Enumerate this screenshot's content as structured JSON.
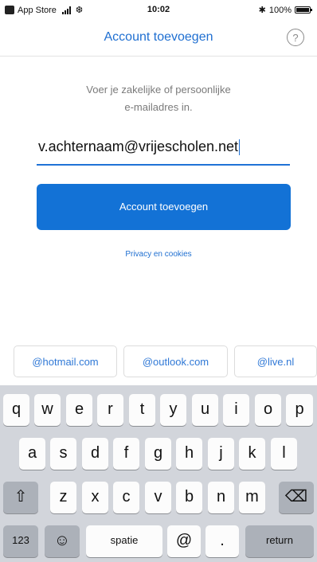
{
  "status_bar": {
    "carrier": "App Store",
    "wifi_glyph": "❆",
    "time": "10:02",
    "bluetooth_glyph": "✱",
    "battery_text": "100%",
    "battery_level": 1.0
  },
  "nav": {
    "title": "Account toevoegen",
    "help_glyph": "?"
  },
  "form": {
    "instruction_line1": "Voer je zakelijke of persoonlijke",
    "instruction_line2": "e-mailadres in.",
    "email_value": "v.achternaam@vrijescholen.net",
    "submit_label": "Account toevoegen",
    "privacy_link": "Privacy en cookies"
  },
  "suggestions": [
    "@hotmail.com",
    "@outlook.com",
    "@live.nl"
  ],
  "keyboard": {
    "row1": [
      "q",
      "w",
      "e",
      "r",
      "t",
      "y",
      "u",
      "i",
      "o",
      "p"
    ],
    "row2": [
      "a",
      "s",
      "d",
      "f",
      "g",
      "h",
      "j",
      "k",
      "l"
    ],
    "row3": [
      "z",
      "x",
      "c",
      "v",
      "b",
      "n",
      "m"
    ],
    "shift_glyph": "⇧",
    "delete_glyph": "⌫",
    "numbers_label": "123",
    "emoji_glyph": "☺",
    "space_label": "spatie",
    "at_label": "@",
    "dot_label": ".",
    "return_label": "return"
  },
  "colors": {
    "accent": "#1372d6",
    "keyboard_bg": "#d2d5db",
    "key_dark": "#acb1b9"
  }
}
